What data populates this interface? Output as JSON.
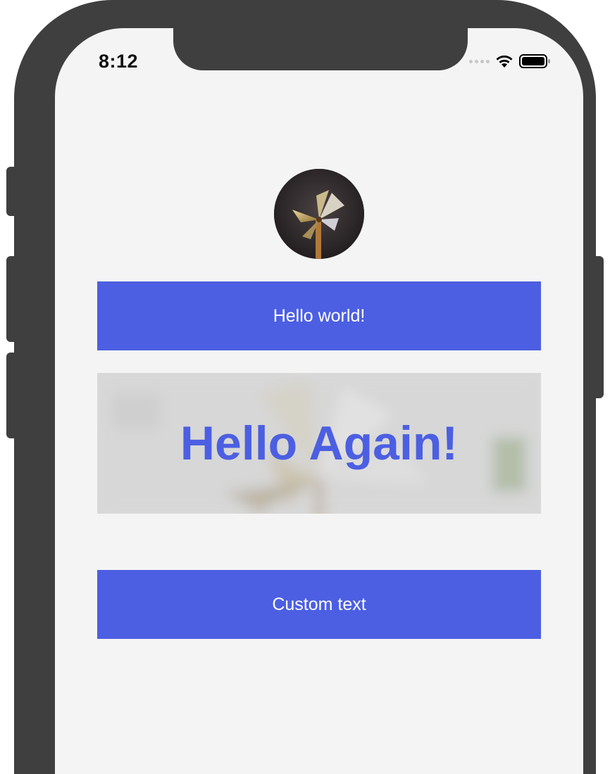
{
  "status_bar": {
    "time": "8:12"
  },
  "avatar": {
    "icon": "pinwheel-photo"
  },
  "buttons": {
    "hello_label": "Hello world!",
    "custom_label": "Custom text"
  },
  "banner": {
    "title": "Hello Again!",
    "background_icon": "blurred-pinwheel-photo"
  },
  "colors": {
    "accent": "#4c5fe2",
    "screen_background": "#f4f4f4",
    "device_frame": "#3f3f3f",
    "banner_background": "#d9d9d9"
  }
}
